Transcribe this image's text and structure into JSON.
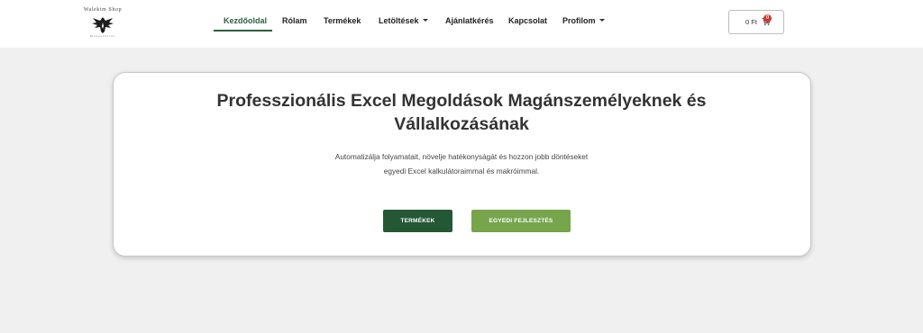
{
  "brand": {
    "name": "Walekim Shop",
    "tagline": "Mezőszállás"
  },
  "nav": {
    "items": [
      {
        "label": "Kezdőoldal",
        "active": true
      },
      {
        "label": "Rólam"
      },
      {
        "label": "Termékek"
      },
      {
        "label": "Letöltések",
        "has_dropdown": true
      },
      {
        "label": "Ajánlatkérés"
      },
      {
        "label": "Kapcsolat"
      },
      {
        "label": "Profilom",
        "has_dropdown": true
      }
    ],
    "active_color": "#2b5e3c"
  },
  "cart": {
    "amount": "0 Ft",
    "count": "0",
    "badge_color": "#d9342b"
  },
  "hero": {
    "title_line1": "Professzionális Excel Megoldások Magánszemélyeknek és",
    "title_line2": "Vállalkozásának",
    "subtitle_line1": "Automatizálja folyamatait, növelje hatékonyságát és hozzon jobb döntéseket",
    "subtitle_line2": "egyedi Excel kalkulátoraimmal és makróimmal.",
    "primary_button": "TERMÉKEK",
    "secondary_button": "EGYEDI FEJLESZTÉS",
    "primary_color": "#245734",
    "secondary_color": "#76a54c"
  }
}
